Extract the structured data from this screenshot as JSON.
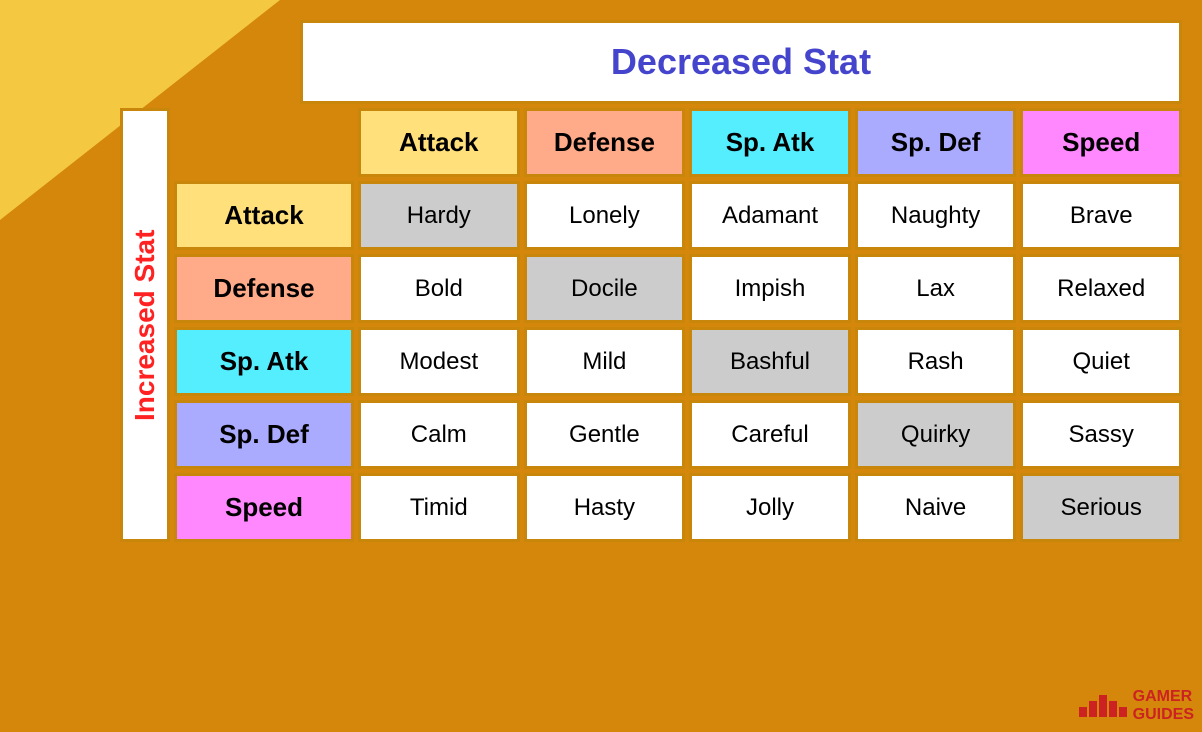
{
  "header": {
    "decreased_stat": "Decreased Stat",
    "increased_stat": "Increased Stat"
  },
  "columns": [
    "Attack",
    "Defense",
    "Sp. Atk",
    "Sp. Def",
    "Speed"
  ],
  "rows": [
    {
      "stat": "Attack",
      "natures": [
        "Hardy",
        "Lonely",
        "Adamant",
        "Naughty",
        "Brave"
      ],
      "neutral_index": 0
    },
    {
      "stat": "Defense",
      "natures": [
        "Bold",
        "Docile",
        "Impish",
        "Lax",
        "Relaxed"
      ],
      "neutral_index": 1
    },
    {
      "stat": "Sp. Atk",
      "natures": [
        "Modest",
        "Mild",
        "Bashful",
        "Rash",
        "Quiet"
      ],
      "neutral_index": 2
    },
    {
      "stat": "Sp. Def",
      "natures": [
        "Calm",
        "Gentle",
        "Careful",
        "Quirky",
        "Sassy"
      ],
      "neutral_index": 3
    },
    {
      "stat": "Speed",
      "natures": [
        "Timid",
        "Hasty",
        "Jolly",
        "Naive",
        "Serious"
      ],
      "neutral_index": 4
    }
  ],
  "logo": {
    "text": "GAMER\nGUIDES"
  }
}
